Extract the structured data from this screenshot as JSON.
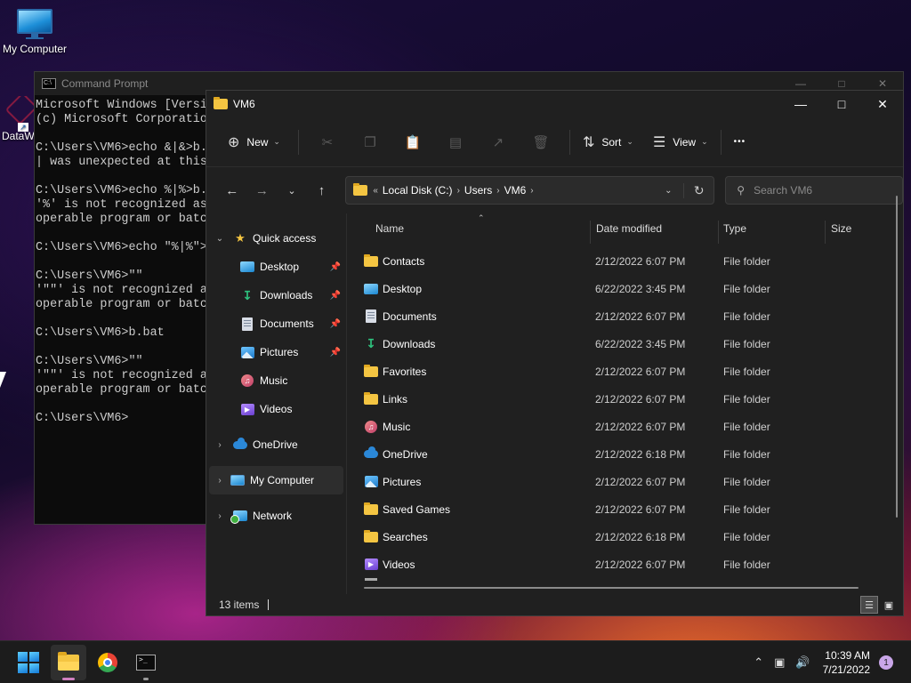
{
  "desktop": {
    "icons": [
      {
        "label": "My Computer"
      },
      {
        "label": "DataW"
      }
    ]
  },
  "cmd": {
    "title": "Command Prompt",
    "lines": [
      "Microsoft Windows [Versi",
      "(c) Microsoft Corporatio",
      "",
      "C:\\Users\\VM6>echo &|&>b.",
      "| was unexpected at this",
      "",
      "C:\\Users\\VM6>echo %|%>b.",
      "'%' is not recognized as",
      "operable program or batc",
      "",
      "C:\\Users\\VM6>echo \"%|%\">",
      "",
      "C:\\Users\\VM6>\"\"",
      "'\"\"' is not recognized a",
      "operable program or batc",
      "",
      "C:\\Users\\VM6>b.bat",
      "",
      "C:\\Users\\VM6>\"\"",
      "'\"\"' is not recognized a",
      "operable program or batc",
      "",
      "C:\\Users\\VM6>"
    ]
  },
  "explorer": {
    "title": "VM6",
    "toolbar": {
      "new_label": "New",
      "sort_label": "Sort",
      "view_label": "View",
      "more_label": "•••"
    },
    "address": {
      "overflow": "«",
      "crumbs": [
        "Local Disk (C:)",
        "Users",
        "VM6"
      ]
    },
    "search": {
      "placeholder": "Search VM6"
    },
    "nav": {
      "quick_access": "Quick access",
      "pinned": [
        {
          "label": "Desktop",
          "icon": "desktop-icon"
        },
        {
          "label": "Downloads",
          "icon": "downloads-icon"
        },
        {
          "label": "Documents",
          "icon": "documents-icon"
        },
        {
          "label": "Pictures",
          "icon": "pictures-icon"
        }
      ],
      "unpinned": [
        {
          "label": "Music",
          "icon": "music-icon"
        },
        {
          "label": "Videos",
          "icon": "videos-icon"
        }
      ],
      "onedrive": "OneDrive",
      "my_computer": "My Computer",
      "network": "Network"
    },
    "columns": {
      "name": "Name",
      "date": "Date modified",
      "type": "Type",
      "size": "Size"
    },
    "rows": [
      {
        "name": "Contacts",
        "date": "2/12/2022 6:07 PM",
        "type": "File folder",
        "icon": "folder"
      },
      {
        "name": "Desktop",
        "date": "6/22/2022 3:45 PM",
        "type": "File folder",
        "icon": "desktop"
      },
      {
        "name": "Documents",
        "date": "2/12/2022 6:07 PM",
        "type": "File folder",
        "icon": "doc"
      },
      {
        "name": "Downloads",
        "date": "6/22/2022 3:45 PM",
        "type": "File folder",
        "icon": "down"
      },
      {
        "name": "Favorites",
        "date": "2/12/2022 6:07 PM",
        "type": "File folder",
        "icon": "folder"
      },
      {
        "name": "Links",
        "date": "2/12/2022 6:07 PM",
        "type": "File folder",
        "icon": "folder"
      },
      {
        "name": "Music",
        "date": "2/12/2022 6:07 PM",
        "type": "File folder",
        "icon": "music"
      },
      {
        "name": "OneDrive",
        "date": "2/12/2022 6:18 PM",
        "type": "File folder",
        "icon": "cloud"
      },
      {
        "name": "Pictures",
        "date": "2/12/2022 6:07 PM",
        "type": "File folder",
        "icon": "pic"
      },
      {
        "name": "Saved Games",
        "date": "2/12/2022 6:07 PM",
        "type": "File folder",
        "icon": "folder"
      },
      {
        "name": "Searches",
        "date": "2/12/2022 6:18 PM",
        "type": "File folder",
        "icon": "folder"
      },
      {
        "name": "Videos",
        "date": "2/12/2022 6:07 PM",
        "type": "File folder",
        "icon": "video"
      }
    ],
    "status": {
      "item_count": "13 items"
    }
  },
  "taskbar": {
    "time": "10:39 AM",
    "date": "7/21/2022",
    "notification_count": "1"
  }
}
